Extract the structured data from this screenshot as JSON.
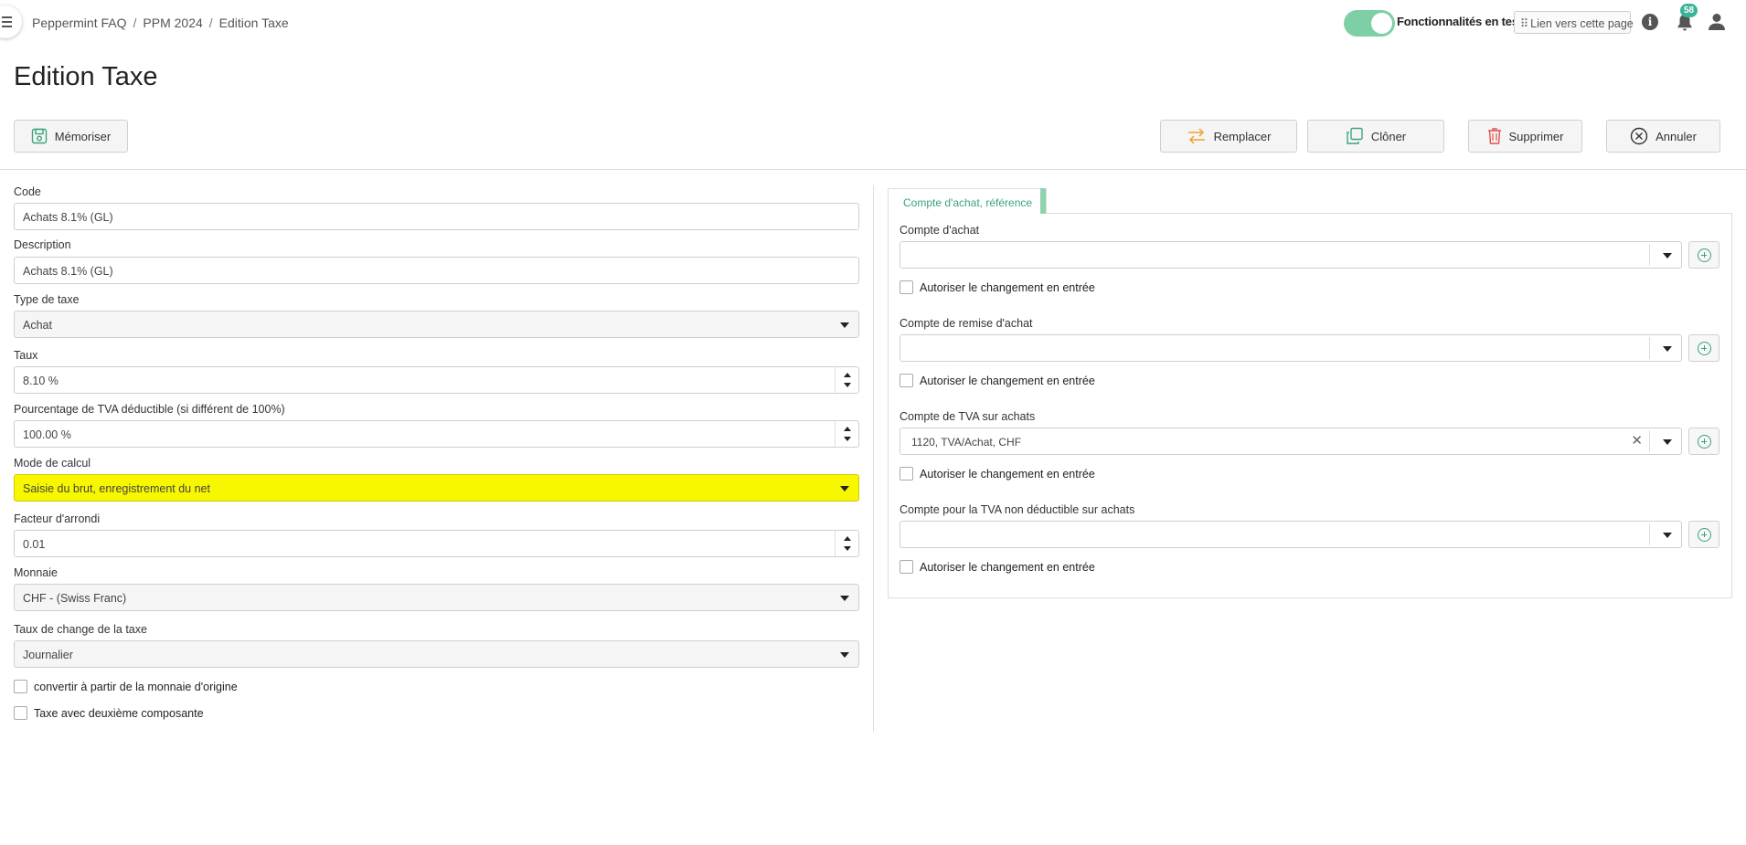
{
  "breadcrumb": [
    "Peppermint FAQ",
    "PPM 2024",
    "Edition Taxe"
  ],
  "header": {
    "feature_toggle_label": "Fonctionnalités en test",
    "feature_toggle_on": true,
    "link_page_label": "Lien vers cette page",
    "notification_count": "58"
  },
  "page_title": "Edition Taxe",
  "toolbar": {
    "save_label": "Mémoriser",
    "replace_label": "Remplacer",
    "clone_label": "Clôner",
    "delete_label": "Supprimer",
    "cancel_label": "Annuler"
  },
  "form": {
    "code": {
      "label": "Code",
      "value": "Achats 8.1% (GL)"
    },
    "description": {
      "label": "Description",
      "value": "Achats 8.1% (GL)"
    },
    "tax_type": {
      "label": "Type de taxe",
      "value": "Achat"
    },
    "rate": {
      "label": "Taux",
      "value": "8.10 %"
    },
    "deductible_pct": {
      "label": "Pourcentage de TVA déductible (si différent de 100%)",
      "value": "100.00 %"
    },
    "calc_mode": {
      "label": "Mode de calcul",
      "value": "Saisie du brut, enregistrement du net"
    },
    "rounding": {
      "label": "Facteur d'arrondi",
      "value": "0.01"
    },
    "currency": {
      "label": "Monnaie",
      "value": "CHF - (Swiss Franc)"
    },
    "exchange_rate": {
      "label": "Taux de change de la taxe",
      "value": "Journalier"
    },
    "convert_origin": {
      "label": "convertir à partir de la monnaie d'origine",
      "checked": false
    },
    "second_component": {
      "label": "Taxe avec deuxième composante",
      "checked": false
    }
  },
  "right_panel": {
    "tab_label": "Compte d'achat, référence",
    "allow_change_label": "Autoriser le changement en entrée",
    "purchase_account": {
      "label": "Compte d'achat",
      "value": ""
    },
    "purchase_discount_account": {
      "label": "Compte de remise d'achat",
      "value": ""
    },
    "vat_purchase_account": {
      "label": "Compte de TVA sur achats",
      "value": "1120, TVA/Achat, CHF"
    },
    "nondeductible_vat_account": {
      "label": "Compte pour la TVA non déductible sur achats",
      "value": ""
    }
  },
  "colors": {
    "accent": "#3aa37a",
    "toggle": "#7fcfa6",
    "highlight": "#f7f700",
    "badge": "#3ab39b"
  }
}
